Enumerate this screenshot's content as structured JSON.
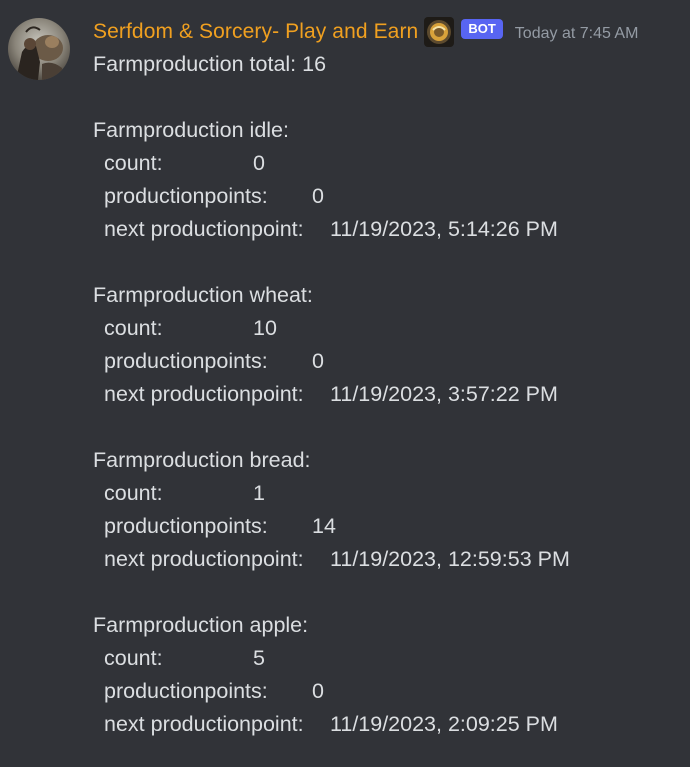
{
  "author": {
    "name": "Serfdom & Sorcery- Play and Earn",
    "bot_tag": "BOT",
    "timestamp": "Today at 7:45 AM"
  },
  "message": {
    "total_line": "Farmproduction total: 16",
    "sections": [
      {
        "title": "Farmproduction idle:",
        "count_label": "count:",
        "count": "0",
        "pp_label": "productionpoints:",
        "pp": "0",
        "next_label": "next productionpoint:",
        "next": "11/19/2023, 5:14:26 PM"
      },
      {
        "title": "Farmproduction wheat:",
        "count_label": "count:",
        "count": "10",
        "pp_label": "productionpoints:",
        "pp": "0",
        "next_label": "next productionpoint:",
        "next": "11/19/2023, 3:57:22 PM"
      },
      {
        "title": "Farmproduction bread:",
        "count_label": "count:",
        "count": "1",
        "pp_label": "productionpoints:",
        "pp": "14",
        "next_label": "next productionpoint:",
        "next": "11/19/2023, 12:59:53 PM"
      },
      {
        "title": "Farmproduction apple:",
        "count_label": "count:",
        "count": "5",
        "pp_label": "productionpoints:",
        "pp": "0",
        "next_label": "next productionpoint:",
        "next": "11/19/2023, 2:09:25 PM"
      }
    ]
  },
  "colors": {
    "background": "#313338",
    "username": "#f0a020",
    "bot_tag": "#5865f2",
    "text": "#dbdee1",
    "timestamp": "#949ba4"
  },
  "icons": {
    "avatar": "avatar-image",
    "app_icon": "app-emblem-icon"
  }
}
